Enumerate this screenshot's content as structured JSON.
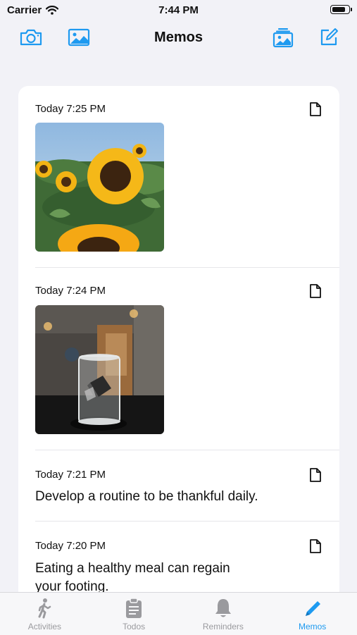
{
  "status_bar": {
    "carrier": "Carrier",
    "time": "7:44 PM",
    "battery_level": 0.9
  },
  "nav": {
    "title": "Memos",
    "left_icons": [
      "camera-icon",
      "photo-icon"
    ],
    "right_icons": [
      "photo-stack-icon",
      "compose-icon"
    ]
  },
  "memos": [
    {
      "time": "Today 7:25 PM",
      "kind": "image",
      "image": "sunflowers-photo"
    },
    {
      "time": "Today 7:24 PM",
      "kind": "image",
      "image": "glass-jar-photo"
    },
    {
      "time": "Today 7:21 PM",
      "kind": "text",
      "text": "Develop a routine to be thankful daily."
    },
    {
      "time": "Today 7:20 PM",
      "kind": "text",
      "text_line1": "Eating a healthy meal can regain",
      "text_line2": "your footing."
    }
  ],
  "tabs": [
    {
      "label": "Activities",
      "icon": "walking-icon"
    },
    {
      "label": "Todos",
      "icon": "clipboard-icon"
    },
    {
      "label": "Reminders",
      "icon": "bell-icon"
    },
    {
      "label": "Memos",
      "icon": "pencil-icon",
      "active": true
    }
  ],
  "colors": {
    "accent": "#1e9af0",
    "inactive": "#9a9a9e",
    "background": "#f2f2f7"
  }
}
